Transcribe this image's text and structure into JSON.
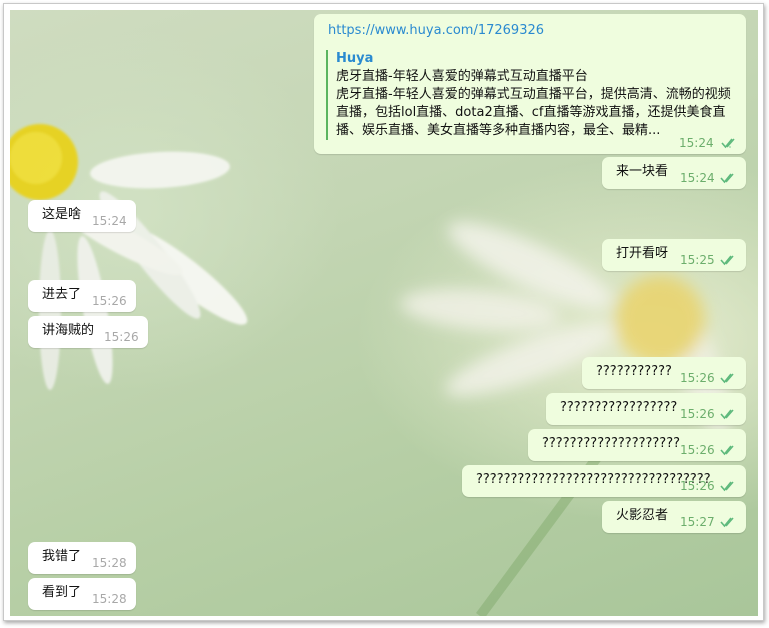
{
  "chat": {
    "link_message": {
      "url": "https://www.huya.com/17269326",
      "preview_title": "Huya",
      "preview_subtitle": "虎牙直播-年轻人喜爱的弹幕式互动直播平台",
      "preview_desc_1": "虎牙直播-年轻人喜爱的弹幕式互动直播平台，提供高清、流畅的视频",
      "preview_desc_2": "直播，包括lol直播、dota2直播、cf直播等游戏直播，还提供美食直",
      "preview_desc_3": "播、娱乐直播、美女直播等多种直播内容，最全、最精...",
      "time": "15:24"
    },
    "messages": [
      {
        "side": "out",
        "text": "来一块看",
        "time": "15:24"
      },
      {
        "side": "in",
        "text": "这是啥",
        "time": "15:24"
      },
      {
        "side": "out",
        "text": "打开看呀",
        "time": "15:25"
      },
      {
        "side": "in",
        "text": "进去了",
        "time": "15:26"
      },
      {
        "side": "in",
        "text": "讲海贼的",
        "time": "15:26"
      },
      {
        "side": "out",
        "text": "???????????",
        "time": "15:26"
      },
      {
        "side": "out",
        "text": "?????????????????",
        "time": "15:26"
      },
      {
        "side": "out",
        "text": "????????????????????",
        "time": "15:26"
      },
      {
        "side": "out",
        "text": "??????????????????????????????????",
        "time": "15:26"
      },
      {
        "side": "out",
        "text": "火影忍者",
        "time": "15:27"
      },
      {
        "side": "in",
        "text": "我错了",
        "time": "15:28"
      },
      {
        "side": "in",
        "text": "看到了",
        "time": "15:28"
      }
    ]
  }
}
